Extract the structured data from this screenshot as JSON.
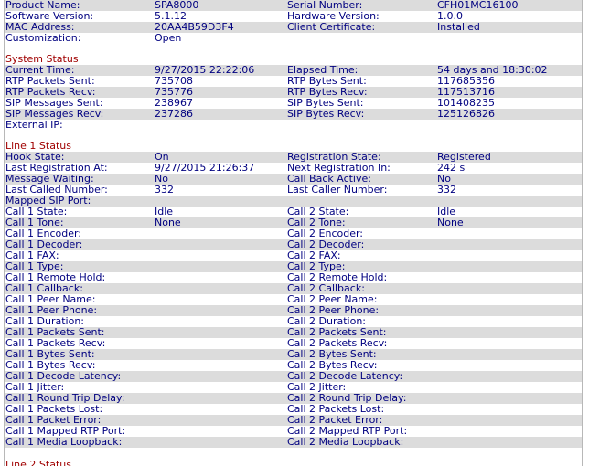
{
  "product": {
    "rows": [
      [
        "Product Name:",
        "SPA8000",
        "Serial Number:",
        "CFH01MC16100"
      ],
      [
        "Software Version:",
        "5.1.12",
        "Hardware Version:",
        "1.0.0"
      ],
      [
        "MAC Address:",
        "20AA4B59D3F4",
        "Client Certificate:",
        "Installed"
      ],
      [
        "Customization:",
        "Open",
        "",
        ""
      ]
    ]
  },
  "system": {
    "title": "System Status",
    "rows": [
      [
        "Current Time:",
        "9/27/2015 22:22:06",
        "Elapsed Time:",
        "54 days and 18:30:02"
      ],
      [
        "RTP Packets Sent:",
        "735708",
        "RTP Bytes Sent:",
        "117685356"
      ],
      [
        "RTP Packets Recv:",
        "735776",
        "RTP Bytes Recv:",
        "117513716"
      ],
      [
        "SIP Messages Sent:",
        "238967",
        "SIP Bytes Sent:",
        "101408235"
      ],
      [
        "SIP Messages Recv:",
        "237286",
        "SIP Bytes Recv:",
        "125126826"
      ],
      [
        "External IP:",
        "",
        "",
        ""
      ]
    ]
  },
  "line1": {
    "title": "Line 1 Status",
    "rows": [
      [
        "Hook State:",
        "On",
        "Registration State:",
        "Registered"
      ],
      [
        "Last Registration At:",
        "9/27/2015 21:26:37",
        "Next Registration In:",
        "242 s"
      ],
      [
        "Message Waiting:",
        "No",
        "Call Back Active:",
        "No"
      ],
      [
        "Last Called Number:",
        "332",
        "Last Caller Number:",
        "332"
      ],
      [
        "Mapped SIP Port:",
        "",
        "",
        ""
      ],
      [
        "Call 1 State:",
        "Idle",
        "Call 2 State:",
        "Idle"
      ],
      [
        "Call 1 Tone:",
        "None",
        "Call 2 Tone:",
        "None"
      ],
      [
        "Call 1 Encoder:",
        "",
        "Call 2 Encoder:",
        ""
      ],
      [
        "Call 1 Decoder:",
        "",
        "Call 2 Decoder:",
        ""
      ],
      [
        "Call 1 FAX:",
        "",
        "Call 2 FAX:",
        ""
      ],
      [
        "Call 1 Type:",
        "",
        "Call 2 Type:",
        ""
      ],
      [
        "Call 1 Remote Hold:",
        "",
        "Call 2 Remote Hold:",
        ""
      ],
      [
        "Call 1 Callback:",
        "",
        "Call 2 Callback:",
        ""
      ],
      [
        "Call 1 Peer Name:",
        "",
        "Call 2 Peer Name:",
        ""
      ],
      [
        "Call 1 Peer Phone:",
        "",
        "Call 2 Peer Phone:",
        ""
      ],
      [
        "Call 1 Duration:",
        "",
        "Call 2 Duration:",
        ""
      ],
      [
        "Call 1 Packets Sent:",
        "",
        "Call 2 Packets Sent:",
        ""
      ],
      [
        "Call 1 Packets Recv:",
        "",
        "Call 2 Packets Recv:",
        ""
      ],
      [
        "Call 1 Bytes Sent:",
        "",
        "Call 2 Bytes Sent:",
        ""
      ],
      [
        "Call 1 Bytes Recv:",
        "",
        "Call 2 Bytes Recv:",
        ""
      ],
      [
        "Call 1 Decode Latency:",
        "",
        "Call 2 Decode Latency:",
        ""
      ],
      [
        "Call 1 Jitter:",
        "",
        "Call 2 Jitter:",
        ""
      ],
      [
        "Call 1 Round Trip Delay:",
        "",
        "Call 2 Round Trip Delay:",
        ""
      ],
      [
        "Call 1 Packets Lost:",
        "",
        "Call 2 Packets Lost:",
        ""
      ],
      [
        "Call 1 Packet Error:",
        "",
        "Call 2 Packet Error:",
        ""
      ],
      [
        "Call 1 Mapped RTP Port:",
        "",
        "Call 2 Mapped RTP Port:",
        ""
      ],
      [
        "Call 1 Media Loopback:",
        "",
        "Call 2 Media Loopback:",
        ""
      ]
    ]
  },
  "line2": {
    "title": "Line 2 Status"
  }
}
